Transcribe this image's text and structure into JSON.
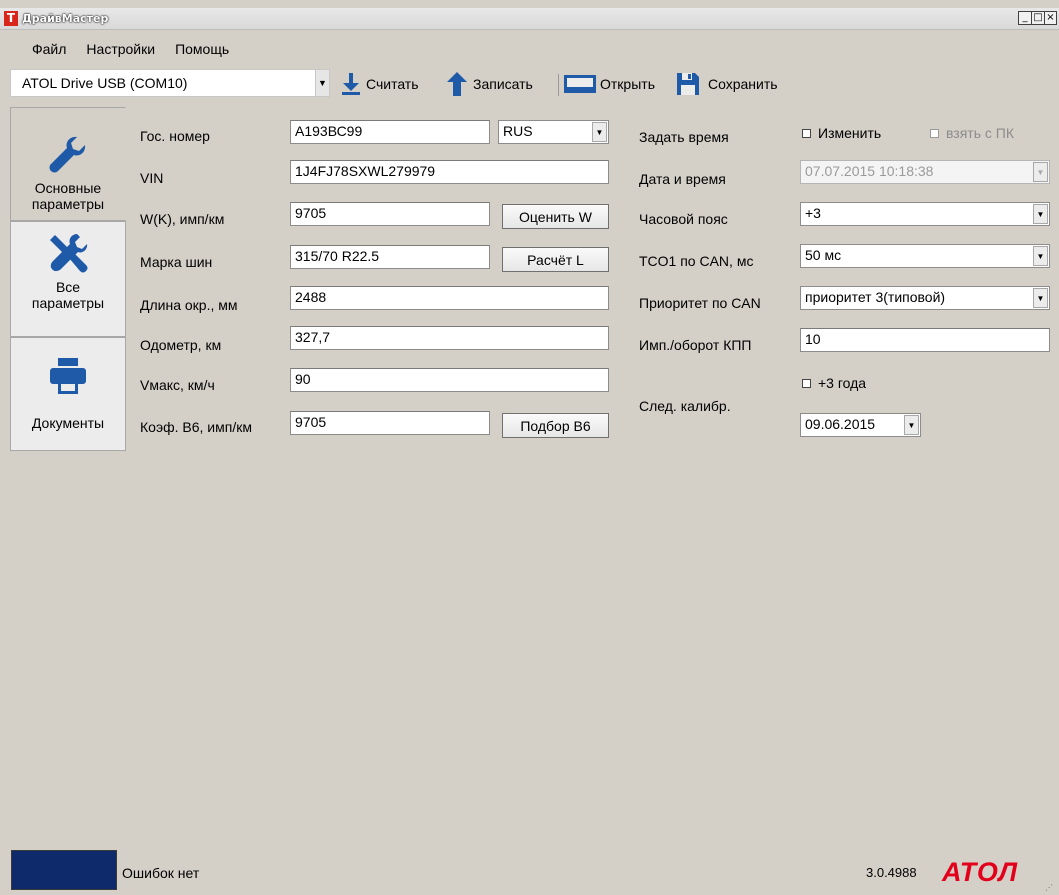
{
  "window": {
    "title": "ДрайвМастер",
    "minimize": "_",
    "maximize": "□",
    "close": "×"
  },
  "menu": [
    "Файл",
    "Настройки",
    "Помощь"
  ],
  "toolbar": {
    "device": "ATOL Drive USB (COM10)",
    "read": "Считать",
    "write": "Записать",
    "open": "Открыть",
    "save": "Сохранить"
  },
  "nav": [
    {
      "label": "Основные параметры",
      "icon": "wrench-icon",
      "active": true
    },
    {
      "label": "Все параметры",
      "icon": "tools-icon",
      "active": false
    },
    {
      "label": "Документы",
      "icon": "printer-icon",
      "active": false
    }
  ],
  "left_form": {
    "plate_label": "Гос. номер",
    "plate_value": "А193ВС99",
    "country": "RUS",
    "vin_label": "VIN",
    "vin_value": "1J4FJ78SXWL279979",
    "w_label": "W(K), имп/км",
    "w_value": "9705",
    "w_button": "Оценить W",
    "tire_label": "Марка шин",
    "tire_value": "315/70 R22.5",
    "tire_button": "Расчёт L",
    "circ_label": "Длина окр., мм",
    "circ_value": "2488",
    "odo_label": "Одометр, км",
    "odo_value": "327,7",
    "vmax_label": "Vмакс, км/ч",
    "vmax_value": "90",
    "b6_label": "Коэф. B6, имп/км",
    "b6_value": "9705",
    "b6_button": "Подбор B6"
  },
  "right_form": {
    "set_time_label": "Задать время",
    "change_check": "Изменить",
    "from_pc_check": "взять с ПК",
    "datetime_label": "Дата и время",
    "datetime_value": "07.07.2015  10:18:38",
    "tz_label": "Часовой пояс",
    "tz_value": "+3",
    "tco_label": "TCO1 по CAN, мс",
    "tco_value": "50 мс",
    "priority_label": "Приоритет по CAN",
    "priority_value": "приоритет 3(типовой)",
    "imp_label": "Имп./оборот КПП",
    "imp_value": "10",
    "plus3_check": "+3 года",
    "calib_label": "След. калибр.",
    "calib_value": "09.06.2015"
  },
  "status": {
    "text": "Ошибок нет",
    "version": "3.0.4988",
    "logo": "АТОЛ",
    "indicator_color": "#0f2a6b"
  },
  "colors": {
    "accent": "#1e5aa8",
    "brand": "#e3001b"
  }
}
